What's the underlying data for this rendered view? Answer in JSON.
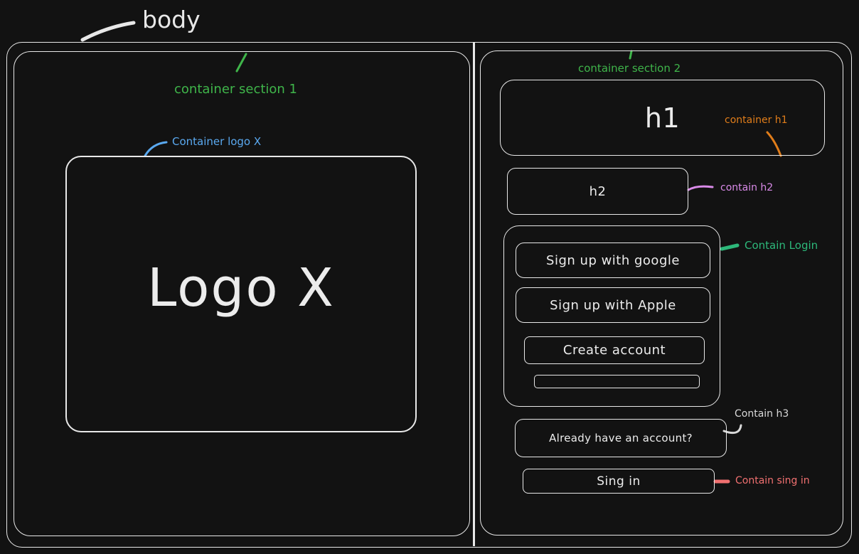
{
  "annotations": {
    "body": "body",
    "container_section_1": "container section 1",
    "container_logo": "Container logo X",
    "container_section_2": "container section 2",
    "container_h1": "container h1",
    "contain_h2": "contain h2",
    "contain_login": "Contain Login",
    "contain_h3": "Contain h3",
    "contain_sign_in": "Contain sing in"
  },
  "section_1": {
    "logo_text": "Logo X"
  },
  "section_2": {
    "h1": "h1",
    "h2": "h2",
    "login": {
      "google_button": "Sign up with google",
      "apple_button": "Sign up with Apple",
      "create_account_button": "Create account"
    },
    "h3": "Already have an account?",
    "sign_in_button": "Sing in"
  },
  "colors": {
    "background": "#121212",
    "stroke": "#e8e8e8",
    "body_label": "#e8e8e8",
    "section_labels": "#3fb54a",
    "logo_label": "#5aa9f0",
    "h1_label": "#e07d1a",
    "h2_label": "#d98ae8",
    "login_label": "#2db87a",
    "h3_label": "#d9d9d9",
    "sign_in_label": "#f07070"
  }
}
